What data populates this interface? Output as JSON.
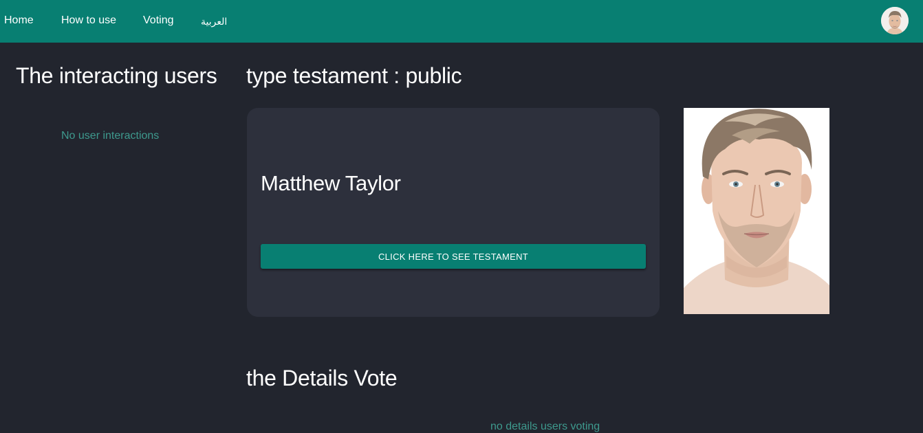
{
  "nav": {
    "items": [
      {
        "label": "Home"
      },
      {
        "label": "How to use"
      },
      {
        "label": "Voting"
      },
      {
        "label": "العربية"
      }
    ],
    "avatar_icon": "user-avatar-icon"
  },
  "sidebar": {
    "title": "The interacting users",
    "empty_text": "No user interactions"
  },
  "main": {
    "type_heading": "type testament : public",
    "card": {
      "name": "Matthew Taylor",
      "button_label": "CLICK HERE TO SEE TESTAMENT"
    },
    "portrait_icon": "person-portrait-image",
    "details_heading": "the Details Vote",
    "details_empty_text": "no details users voting"
  },
  "colors": {
    "accent": "#087f72",
    "background": "#22252e",
    "card": "#2d303c",
    "muted_text": "#3e9a8e"
  }
}
